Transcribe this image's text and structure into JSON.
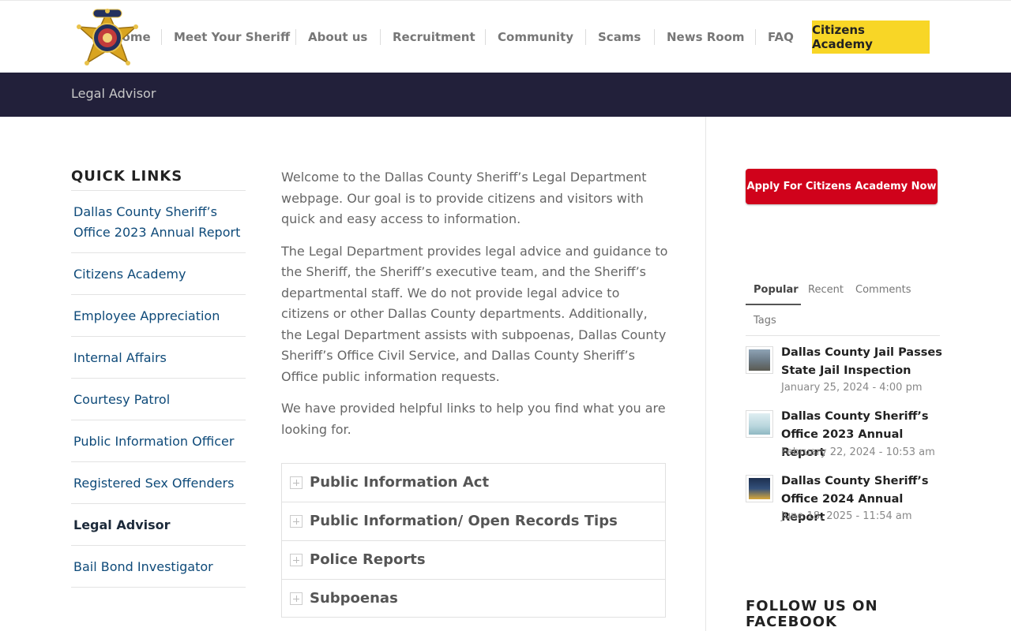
{
  "header": {
    "logo_alt": "Dallas County Sheriff badge",
    "nav": [
      {
        "label": "Home"
      },
      {
        "label": "Meet Your Sheriff"
      },
      {
        "label": "About us"
      },
      {
        "label": "Recruitment"
      },
      {
        "label": "Community"
      },
      {
        "label": "Scams"
      },
      {
        "label": "News Room"
      },
      {
        "label": "FAQ"
      }
    ],
    "cta_label": "Citizens Academy"
  },
  "titlebar": {
    "title": "Legal Advisor"
  },
  "quick_links": {
    "heading": "QUICK LINKS",
    "items": [
      {
        "label": "Dallas County Sheriff’s Office 2023 Annual Report"
      },
      {
        "label": "Citizens Academy"
      },
      {
        "label": "Employee Appreciation"
      },
      {
        "label": "Internal Affairs"
      },
      {
        "label": "Courtesy Patrol"
      },
      {
        "label": "Public Information Officer"
      },
      {
        "label": "Registered Sex Offenders"
      },
      {
        "label": "Legal Advisor"
      },
      {
        "label": "Bail Bond Investigator"
      }
    ]
  },
  "main": {
    "paragraphs": [
      "Welcome to the Dallas County Sheriff’s Legal Department webpage.  Our goal is to provide citizens and visitors with quick and easy access to information.",
      "The Legal Department provides legal advice and guidance to the Sheriff, the Sheriff’s executive team, and the Sheriff’s departmental staff.  We do not provide legal advice to citizens or other Dallas County departments. Additionally, the Legal Department assists with subpoenas, Dallas County Sheriff’s Office Civil Service, and Dallas County Sheriff’s Office public information requests.",
      "We have provided helpful links to help you find what you are looking for."
    ],
    "accordion": [
      {
        "label": "Public Information Act"
      },
      {
        "label": "Public Information/ Open Records Tips"
      },
      {
        "label": "Police Reports"
      },
      {
        "label": "Subpoenas"
      }
    ]
  },
  "sidebar": {
    "apply_button": "Apply For Citizens Academy Now",
    "tabs": [
      {
        "label": "Popular"
      },
      {
        "label": "Recent"
      },
      {
        "label": "Comments"
      },
      {
        "label": "Tags"
      }
    ],
    "posts": [
      {
        "title": "Dallas County Jail Passes State Jail Inspection",
        "date": "January 25, 2024 - 4:00 pm"
      },
      {
        "title": "Dallas County Sheriff’s Office 2023 Annual Report",
        "date": "February 22, 2024 - 10:53 am"
      },
      {
        "title": "Dallas County Sheriff’s Office 2024 Annual Report",
        "date": "June 18, 2025 - 11:54 am"
      }
    ],
    "follow_heading": "FOLLOW US ON FACEBOOK"
  },
  "colors": {
    "titlebar_bg": "#22203a",
    "cta_bg": "#f8d626",
    "apply_bg": "#d0021b",
    "link": "#0e4a79"
  }
}
